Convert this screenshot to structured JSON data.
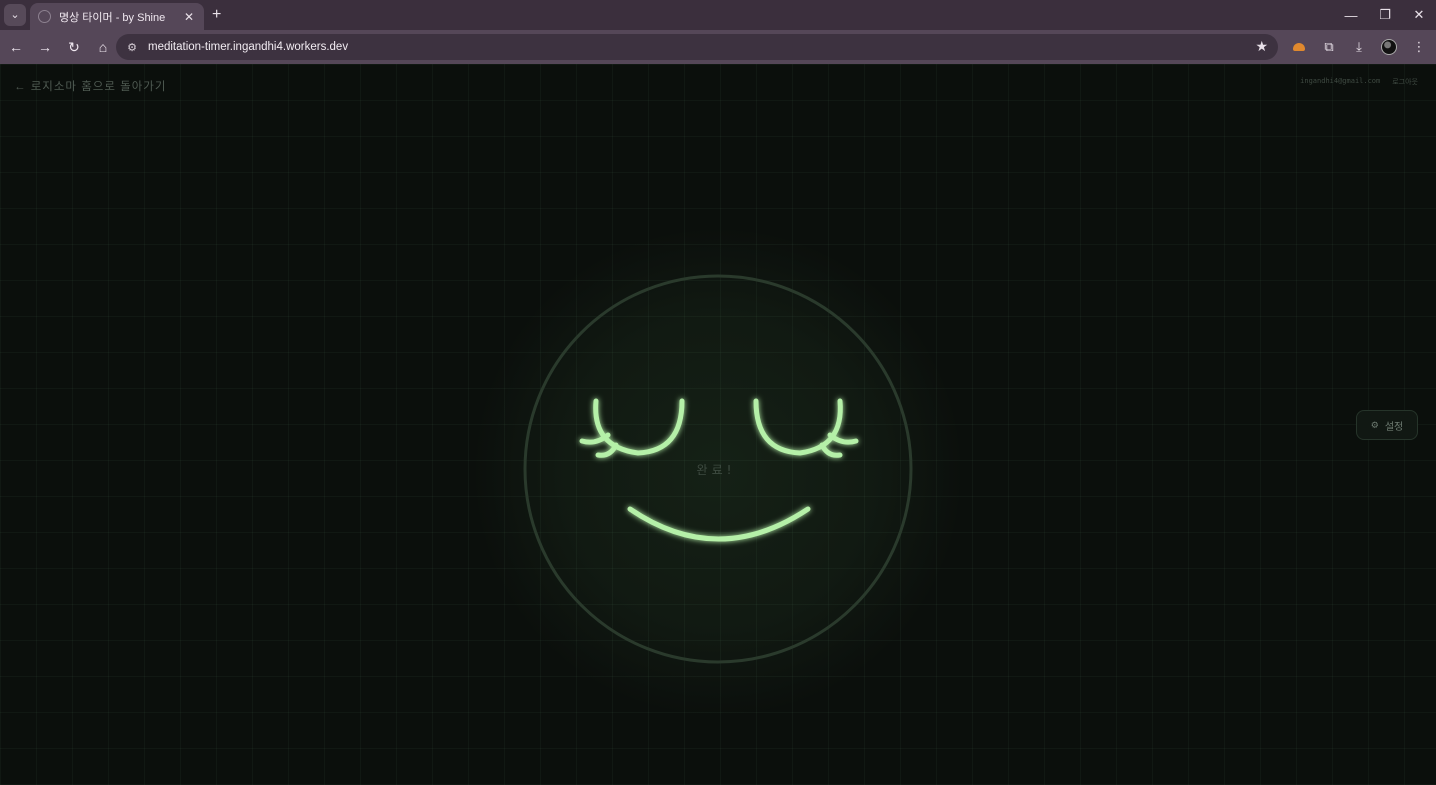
{
  "browser": {
    "tab_title": "명상 타이머 - by Shine",
    "url": "meditation-timer.ingandhi4.workers.dev",
    "icons": {
      "tab_search": "chevron-down-icon",
      "tab_close": "close-icon",
      "new_tab": "plus-icon",
      "back": "arrow-left-icon",
      "forward": "arrow-right-icon",
      "reload": "reload-icon",
      "home": "home-icon",
      "site_info": "tune-icon",
      "bookmark": "star-icon",
      "extensions": "puzzle-icon",
      "downloads": "download-icon",
      "menu": "kebab-menu-icon"
    }
  },
  "page": {
    "back_link": "← 로지소마 홈으로 돌아가기",
    "user_email": "ingandhi4@gmail.com",
    "logout_label": "로그아웃",
    "center_text": "완료!",
    "settings_label": "설정",
    "colors": {
      "background": "#0b0f0c",
      "face_ring": "#2a3a2c",
      "face_feature": "#b5f0a8",
      "muted_text": "#4f5a52"
    }
  }
}
